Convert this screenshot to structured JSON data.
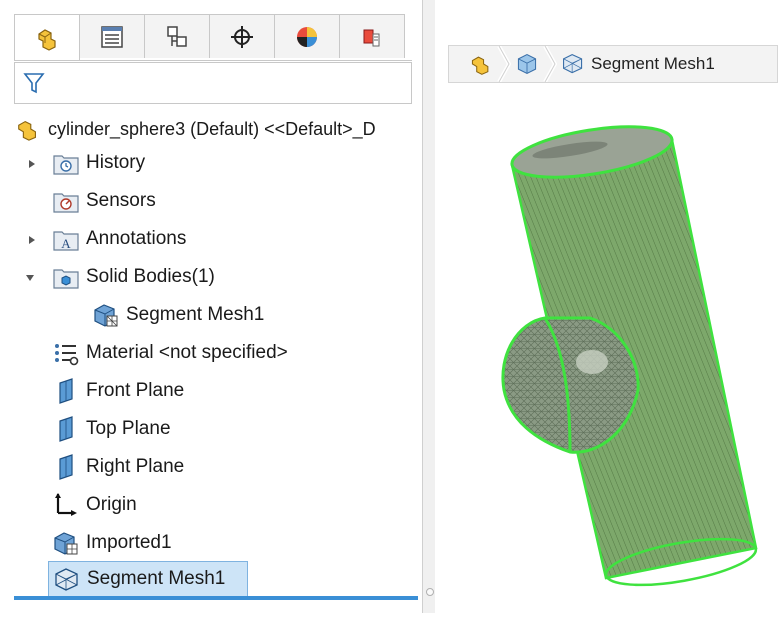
{
  "tabs": [
    {
      "icon": "feature-manager-icon",
      "active": true
    },
    {
      "icon": "property-manager-icon"
    },
    {
      "icon": "configuration-manager-icon"
    },
    {
      "icon": "dimxpert-icon"
    },
    {
      "icon": "display-manager-icon"
    },
    {
      "icon": "cam-icon"
    }
  ],
  "filter": {
    "icon": "filter-icon"
  },
  "tree": {
    "root": "cylinder_sphere3 (Default) <<Default>_D",
    "items": [
      {
        "label": "History",
        "icon": "history-folder-icon",
        "expandable": true
      },
      {
        "label": "Sensors",
        "icon": "sensors-folder-icon"
      },
      {
        "label": "Annotations",
        "icon": "annotations-folder-icon",
        "expandable": true
      },
      {
        "label": "Solid Bodies(1)",
        "icon": "solid-bodies-folder-icon",
        "expanded": true
      },
      {
        "label": "Segment Mesh1",
        "icon": "mesh-body-icon",
        "child": true
      },
      {
        "label": "Material <not specified>",
        "icon": "material-icon"
      },
      {
        "label": "Front Plane",
        "icon": "plane-icon"
      },
      {
        "label": "Top Plane",
        "icon": "plane-icon"
      },
      {
        "label": "Right Plane",
        "icon": "plane-icon"
      },
      {
        "label": "Origin",
        "icon": "origin-icon"
      },
      {
        "label": "Imported1",
        "icon": "imported-feature-icon"
      },
      {
        "label": "Segment Mesh1",
        "icon": "segment-mesh-icon",
        "selected": true
      }
    ]
  },
  "breadcrumb": {
    "items": [
      "part-icon",
      "solid-body-icon",
      "segment-mesh-icon"
    ],
    "label": "Segment Mesh1"
  },
  "colors": {
    "mesh_edge": "#3fe23f",
    "mesh_fill": "#7da86b",
    "selection": "#cde4f7",
    "accent": "#3a8fd6"
  }
}
